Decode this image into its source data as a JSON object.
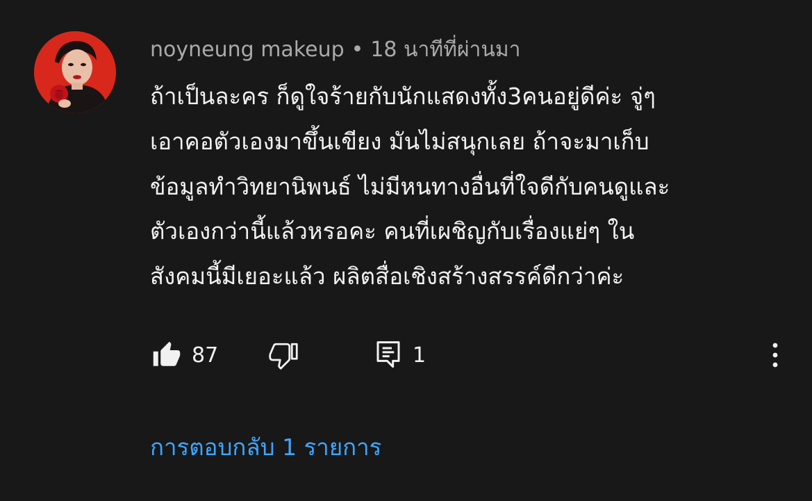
{
  "comment": {
    "author": "noyneung makeup",
    "separator": "•",
    "timestamp": "18 นาทีที่ผ่านมา",
    "lines": [
      "ถ้าเป็นละคร ก็ดูใจร้ายกับนักแสดงทั้ง3คนอยู่ดีค่ะ จู่ๆ",
      "เอาคอตัวเองมาขึ้นเขียง มันไม่สนุกเลย ถ้าจะมาเก็บ",
      "ข้อมูลทำวิทยานิพนธ์ ไม่มีหนทางอื่นที่ใจดีกับคนดูและ",
      "ตัวเองกว่านี้แล้วหรอคะ คนที่เผชิญกับเรื่องแย่ๆ ใน",
      "สังคมนี้มีเยอะแล้ว ผลิตสื่อเชิงสร้างสรรค์ดีกว่าค่ะ"
    ],
    "like_count": "87",
    "reply_count": "1",
    "view_replies": "การตอบกลับ 1 รายการ"
  },
  "icons": {
    "avatar": "avatar-photo",
    "like": "thumbs-up-icon",
    "dislike": "thumbs-down-icon",
    "reply": "comment-reply-icon",
    "more": "more-vertical-icon"
  },
  "colors": {
    "background": "#181818",
    "text": "#f1f1f1",
    "secondary_text": "#aaaaaa",
    "link": "#3ea6ff",
    "avatar_background": "#d8281c"
  }
}
